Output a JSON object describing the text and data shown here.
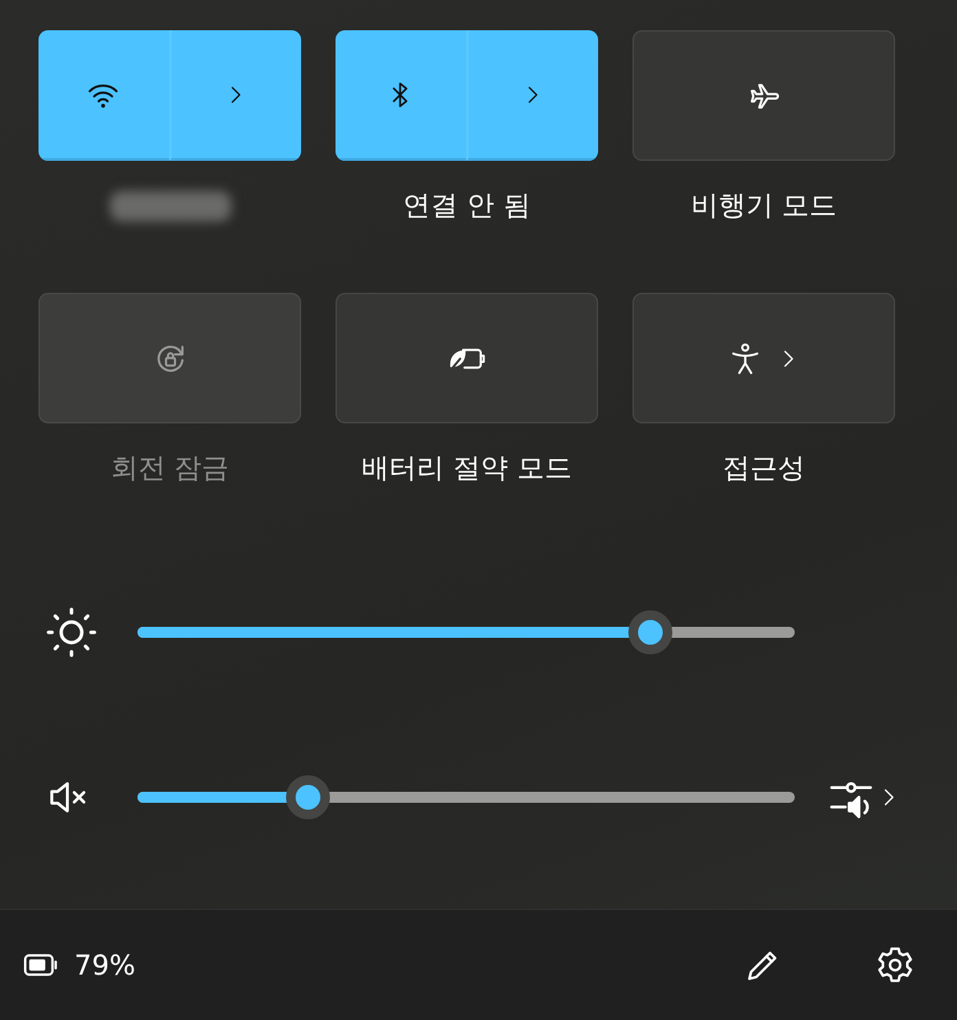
{
  "tiles": [
    {
      "kind": "split",
      "on": true
    },
    {
      "kind": "split",
      "on": true,
      "label": "연결 안 됨"
    },
    {
      "kind": "single",
      "on": false,
      "disabled": false,
      "label": "비행기 모드"
    },
    {
      "kind": "single",
      "on": false,
      "disabled": true,
      "label": "회전 잠금"
    },
    {
      "kind": "single",
      "on": false,
      "disabled": false,
      "label": "배터리 절약 모드"
    },
    {
      "kind": "chevron",
      "on": false,
      "disabled": false,
      "label": "접근성"
    }
  ],
  "sliders": [
    {
      "kind": "brightness",
      "level": 0.78
    },
    {
      "kind": "volume",
      "level": 0.26,
      "muted": true
    }
  ],
  "footer": {
    "battery": "79%"
  }
}
